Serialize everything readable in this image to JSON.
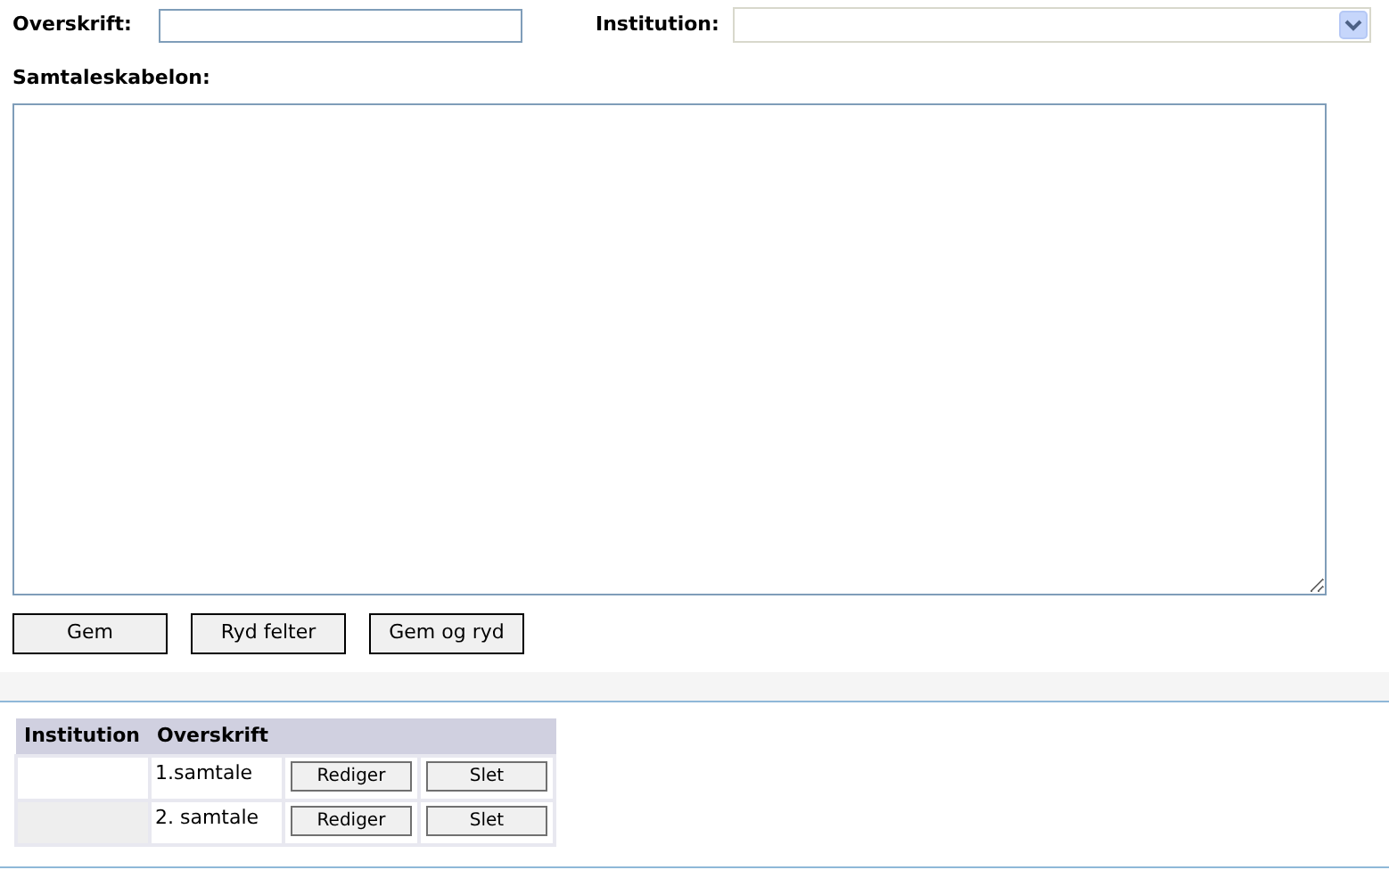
{
  "form": {
    "title_label": "Overskrift:",
    "institution_label": "Institution:",
    "template_label": "Samtaleskabelon:"
  },
  "buttons": [
    "Gem",
    "Ryd felter",
    "Gem og ryd"
  ],
  "table": {
    "columns": [
      "Institution",
      "Overskrift"
    ],
    "rows": [
      {
        "institution": "",
        "title": "1.samtale",
        "edit": "Rediger",
        "delete": "Slet"
      },
      {
        "institution": "",
        "title": "2. samtale",
        "edit": "Rediger",
        "delete": "Slet"
      }
    ]
  }
}
